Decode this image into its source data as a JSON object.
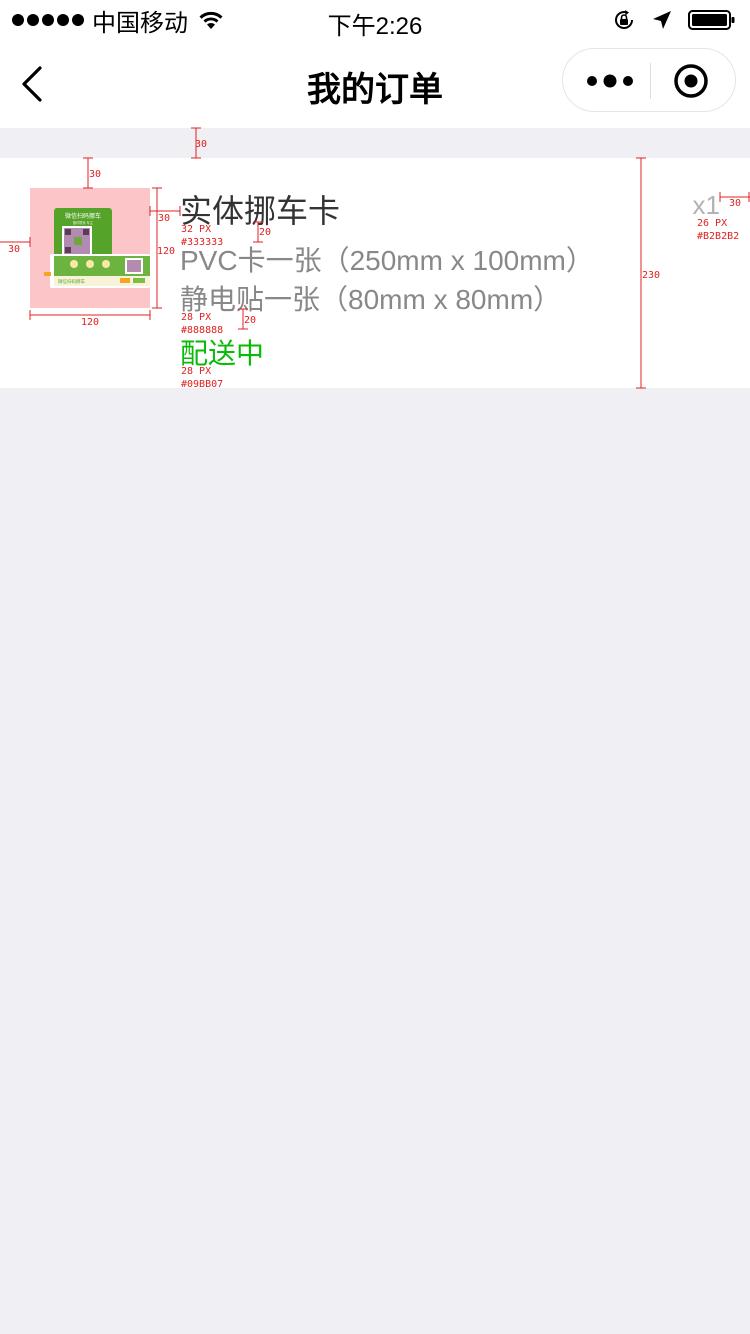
{
  "status_bar": {
    "carrier": "中国移动",
    "time": "下午2:26"
  },
  "nav": {
    "title": "我的订单"
  },
  "order": {
    "product_title": "实体挪车卡",
    "specs": [
      "PVC卡一张（250mm x 100mm）",
      "静电贴一张（80mm x 80mm）"
    ],
    "status": "配送中",
    "quantity": "x1",
    "image_texts": {
      "card_heading": "微信扫码挪车",
      "card_subheading": "随时联系 车主",
      "strip_heading": "微信扫码挪车"
    }
  },
  "annotations": {
    "gap_top": "30",
    "img_top": "30",
    "img_left": "30",
    "img_width": "120",
    "img_height": "120",
    "img_text_gap": "30",
    "title_spec_gap": "20",
    "spec_status_gap": "20",
    "card_height": "230",
    "qty_right": "30",
    "title_font": "32 PX",
    "title_color": "#333333",
    "spec_font": "28 PX",
    "spec_color": "#888888",
    "status_font": "28 PX",
    "status_color": "#09BB07",
    "qty_font": "26 PX",
    "qty_color": "#B2B2B2"
  },
  "colors": {
    "page_bg": "#EFEFF4",
    "title": "#333333",
    "spec": "#888888",
    "status": "#09BB07",
    "quantity": "#B2B2B2",
    "annotation": "#E02020"
  },
  "icons": [
    "signal-dots-icon",
    "wifi-icon",
    "lock-rotation-icon",
    "location-arrow-icon",
    "battery-icon",
    "back-chevron-icon",
    "more-dots-icon",
    "close-target-icon"
  ]
}
